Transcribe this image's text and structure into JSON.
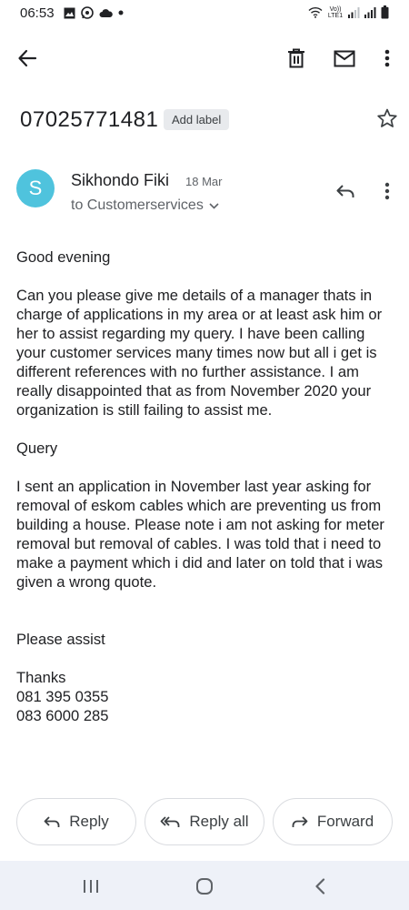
{
  "status_bar": {
    "time": "06:53",
    "network_label": "Vo)) LTE1",
    "icons_left": [
      "gallery-icon",
      "whatsapp-icon",
      "cloud-icon",
      "dot-icon"
    ],
    "icons_right": [
      "wifi-icon",
      "signal-icon",
      "signal-icon",
      "battery-icon"
    ]
  },
  "toolbar": {
    "back": "back-arrow-icon",
    "delete": "trash-icon",
    "mark_unread": "mail-icon",
    "more": "more-vert-icon"
  },
  "message": {
    "subject": "07025771481",
    "label_chip": "Add label",
    "sender_initial": "S",
    "sender_name": "Sikhondo Fiki",
    "date": "18 Mar",
    "recipient": "to Customerservices",
    "greeting": "Good evening",
    "paragraph1": "Can you please give me details of a manager thats in charge of applications in my area or at least ask him or her to assist regarding my query. I have been calling your customer services many times now but all i get is different references with no further assistance. I am really disappointed that as from November 2020 your organization is still failing to assist me.",
    "query_heading": "Query",
    "paragraph2": "I sent an application in November last year asking for removal of eskom cables which are preventing us from building a house. Please note i am not asking for meter removal but removal of cables. I was told that i need to make a payment which i did and later on told that i was given a wrong quote.",
    "closing": "Please assist",
    "thanks": "Thanks",
    "phone1": "081 395 0355",
    "phone2": "083 6000 285"
  },
  "actions": {
    "reply": "Reply",
    "reply_all": "Reply all",
    "forward": "Forward"
  },
  "colors": {
    "avatar": "#4fc3dd",
    "chip_bg": "#e8eaed",
    "nav_bg": "#eef1f8",
    "text": "#202124",
    "secondary": "#5f6368"
  }
}
